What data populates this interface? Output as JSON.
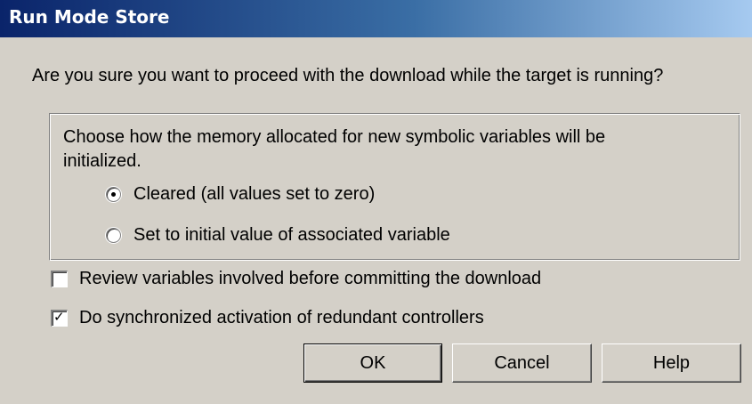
{
  "dialog": {
    "title": "Run Mode Store",
    "question": "Are you sure you want to proceed with the download while the target is running?",
    "group": {
      "description": "Choose how the memory allocated for new symbolic variables will be initialized.",
      "options": [
        {
          "label": "Cleared (all values set to zero)",
          "selected": true
        },
        {
          "label": "Set to initial value of associated variable",
          "selected": false
        }
      ]
    },
    "checkboxes": [
      {
        "label": "Review variables involved before committing the download",
        "checked": false
      },
      {
        "label": "Do synchronized activation of redundant controllers",
        "checked": true
      }
    ],
    "buttons": {
      "ok": "OK",
      "cancel": "Cancel",
      "help": "Help"
    },
    "colors": {
      "face": "#d4d0c8",
      "title_start": "#0a246a",
      "title_end": "#a6caf0"
    }
  }
}
